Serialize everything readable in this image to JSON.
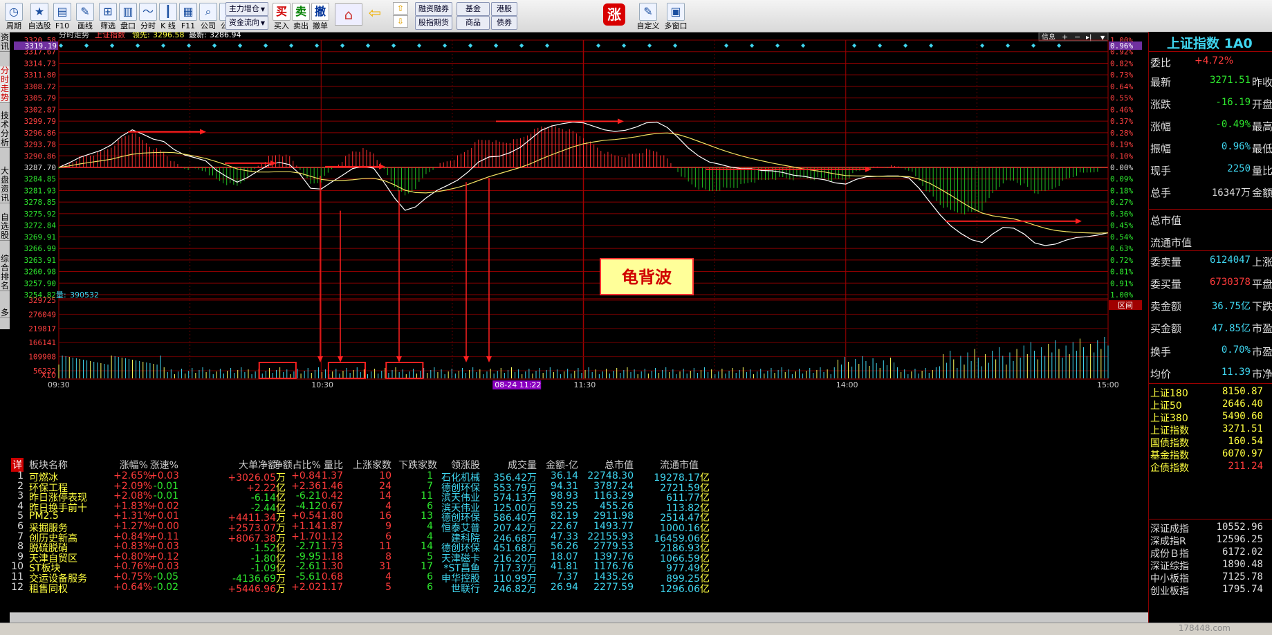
{
  "toolbar": {
    "items": [
      {
        "label": "周期",
        "icon": "clock-icon"
      },
      {
        "label": "自选股",
        "icon": "star-icon"
      },
      {
        "label": "F10",
        "icon": "f10-icon"
      },
      {
        "label": "画线",
        "icon": "pencil-icon"
      },
      {
        "label": "筛选",
        "icon": "filter-icon"
      },
      {
        "label": "盘口",
        "icon": "order-book-icon"
      },
      {
        "label": "分时",
        "icon": "intraday-icon"
      },
      {
        "label": "K 线",
        "icon": "candlestick-icon"
      },
      {
        "label": "F11",
        "icon": "grid-icon"
      },
      {
        "label": "公司",
        "icon": "company-icon"
      },
      {
        "label": "公式",
        "icon": "formula-icon"
      }
    ],
    "dropdowns": [
      "主力增仓",
      "资金流向"
    ],
    "trade": [
      {
        "label": "买入",
        "glyph": "买",
        "color": "#d00000"
      },
      {
        "label": "卖出",
        "glyph": "卖",
        "color": "#008000"
      },
      {
        "label": "撤单",
        "glyph": "撤",
        "color": "#003399"
      }
    ],
    "nav_buttons": [
      "融资融券",
      "基金",
      "港股",
      "股指期货",
      "商品",
      "债券"
    ],
    "zhang_glyph": "涨",
    "right_items": [
      {
        "label": "自定义",
        "icon": "customize-icon"
      },
      {
        "label": "多窗口",
        "icon": "multi-window-icon"
      }
    ]
  },
  "left_tabs": [
    {
      "label": "资讯"
    },
    {
      "label": "分时走势",
      "active": true
    },
    {
      "label": "技术分析"
    },
    {
      "label": "大盘资讯"
    },
    {
      "label": "自选股"
    },
    {
      "label": "综合排名"
    },
    {
      "label": "多"
    }
  ],
  "chart_header": {
    "title": "分时走势",
    "index_name": "上证指数",
    "lead_label": "领先:",
    "lead_value": "3296.58",
    "latest_label": "最新:",
    "latest_value": "3286.94",
    "info_button": "信息",
    "interval_button": "区间"
  },
  "chart_data": {
    "type": "line",
    "prev_close": 3287.7,
    "y_ticks": [
      "3320.58",
      "3317.67",
      "3314.73",
      "3311.80",
      "3308.72",
      "3305.79",
      "3302.87",
      "3299.79",
      "3296.86",
      "3293.78",
      "3290.86",
      "3287.70",
      "3284.85",
      "3281.93",
      "3278.85",
      "3275.92",
      "3272.84",
      "3269.91",
      "3266.99",
      "3263.91",
      "3260.98",
      "3257.90",
      "3254.82"
    ],
    "y_highlight": "3319.19",
    "pct_ticks": [
      "1.00%",
      "0.92%",
      "0.82%",
      "0.73%",
      "0.64%",
      "0.55%",
      "0.46%",
      "0.37%",
      "0.28%",
      "0.19%",
      "0.10%",
      "0.00%",
      "0.09%",
      "0.18%",
      "0.27%",
      "0.36%",
      "0.45%",
      "0.54%",
      "0.63%",
      "0.72%",
      "0.81%",
      "0.91%",
      "1.00%"
    ],
    "pct_highlight": "0.96%",
    "volume_label": "量:",
    "volume_value": "390532",
    "volume_ticks": [
      "329725",
      "276049",
      "219817",
      "166141",
      "109908",
      "56232"
    ],
    "volume_multiplier": "X10",
    "time_labels": [
      "09:30",
      "10:30",
      "11:30",
      "14:00",
      "15:00"
    ],
    "cursor_time": "08-24 11:22",
    "annotation": "龟背波",
    "series": [
      {
        "name": "",
        "values": [
          3287.7,
          3288.9,
          3290.3,
          3291.2,
          3292.1,
          3293.5,
          3295.8,
          3297.4,
          3296.3,
          3295.0,
          3294.4,
          3292.3,
          3290.9,
          3290.2,
          3289.4,
          3287.0,
          3285.3,
          3283.9,
          3285.1,
          3286.8,
          3288.3,
          3289.0,
          3288.4,
          3285.9,
          3282.3,
          3282.1,
          3283.9,
          3285.6,
          3287.4,
          3288.0,
          3287.5,
          3283.8,
          3279.8,
          3276.6,
          3277.5,
          3279.8,
          3281.7,
          3283.0,
          3284.4,
          3286.5,
          3289.1,
          3290.4,
          3290.6,
          3291.5,
          3292.9,
          3295.1,
          3297.3,
          3298.4,
          3299.0,
          3299.4,
          3299.2,
          3298.3,
          3297.4,
          3297.0,
          3297.3,
          3298.1,
          3299.2,
          3299.4,
          3298.0,
          3295.5,
          3292.7,
          3290.6,
          3289.1,
          3288.5,
          3287.8,
          3287.4,
          3287.4,
          3286.9,
          3286.8,
          3286.4,
          3285.7,
          3285.4,
          3284.9,
          3284.5,
          3283.7,
          3283.4,
          3284.6,
          3285.3,
          3285.4,
          3285.5,
          3285.5,
          3285.0,
          3282.3,
          3278.8,
          3275.4,
          3272.6,
          3270.6,
          3269.0,
          3268.3,
          3270.5,
          3272.2,
          3272.0,
          3270.5,
          3268.2,
          3267.5,
          3267.9,
          3268.9,
          3269.6,
          3269.8,
          3270.2,
          3270.8
        ]
      },
      {
        "name": "",
        "values": [
          3287.7,
          3288.1,
          3288.6,
          3289.0,
          3289.4,
          3289.8,
          3290.5,
          3291.1,
          3291.4,
          3291.5,
          3291.6,
          3291.5,
          3291.1,
          3290.6,
          3290.0,
          3289.2,
          3288.3,
          3287.3,
          3286.8,
          3286.5,
          3286.5,
          3286.6,
          3286.6,
          3286.2,
          3285.4,
          3284.6,
          3284.3,
          3284.3,
          3284.5,
          3284.8,
          3284.9,
          3284.3,
          3283.2,
          3281.8,
          3281.2,
          3281.1,
          3281.4,
          3281.9,
          3282.5,
          3283.3,
          3284.3,
          3285.3,
          3286.1,
          3286.9,
          3287.7,
          3288.7,
          3289.9,
          3291.0,
          3292.0,
          3293.0,
          3293.8,
          3294.3,
          3294.7,
          3294.9,
          3295.2,
          3295.6,
          3296.1,
          3296.5,
          3296.6,
          3296.2,
          3295.4,
          3294.4,
          3293.4,
          3292.4,
          3291.5,
          3290.7,
          3290.0,
          3289.4,
          3288.8,
          3288.3,
          3287.8,
          3287.3,
          3286.9,
          3286.5,
          3286.0,
          3285.6,
          3285.5,
          3285.5,
          3285.4,
          3285.4,
          3285.4,
          3285.3,
          3284.7,
          3283.6,
          3282.1,
          3280.5,
          3278.8,
          3277.2,
          3275.9,
          3275.2,
          3274.8,
          3274.4,
          3273.7,
          3272.8,
          3272.0,
          3271.4,
          3271.1,
          3270.9,
          3270.8,
          3270.7,
          3270.8
        ]
      }
    ]
  },
  "table": {
    "headers": [
      "详",
      "板块名称",
      "涨幅%",
      "涨速%",
      "大单净额",
      "净额占比%",
      "量比",
      "上涨家数",
      "下跌家数",
      "领涨股",
      "成交量",
      "金额-亿",
      "总市值",
      "流通市值"
    ],
    "rows": [
      [
        "1",
        "可燃冰",
        "+2.65%",
        "+0.03",
        "+3026.05",
        "万",
        "+0.84",
        "1.37",
        "10",
        "1",
        "石化机械",
        "356.42万",
        "36.14",
        "22748.30",
        "19278.17",
        "亿"
      ],
      [
        "2",
        "环保工程",
        "+2.09%",
        "-0.01",
        "+2.22",
        "亿",
        "+2.36",
        "1.46",
        "24",
        "7",
        "德创环保",
        "553.79万",
        "94.31",
        "3787.24",
        "2721.59",
        "亿"
      ],
      [
        "3",
        "昨日涨停表现",
        "+2.08%",
        "-0.01",
        "-6.14",
        "亿",
        "-6.21",
        "0.42",
        "14",
        "11",
        "滨天伟业",
        "574.13万",
        "98.93",
        "1163.29",
        "611.77",
        "亿"
      ],
      [
        "4",
        "昨日换手前十",
        "+1.83%",
        "+0.02",
        "-2.44",
        "亿",
        "-4.12",
        "0.67",
        "4",
        "6",
        "滨天伟业",
        "125.00万",
        "59.25",
        "455.26",
        "113.82",
        "亿"
      ],
      [
        "5",
        "PM2.5",
        "+1.31%",
        "+0.01",
        "+4411.34",
        "万",
        "+0.54",
        "1.80",
        "16",
        "13",
        "德创环保",
        "586.40万",
        "82.19",
        "2911.98",
        "2514.47",
        "亿"
      ],
      [
        "6",
        "采掘服务",
        "+1.27%",
        "+0.00",
        "+2573.07",
        "万",
        "+1.14",
        "1.87",
        "9",
        "4",
        "恒泰艾普",
        "207.42万",
        "22.67",
        "1493.77",
        "1000.16",
        "亿"
      ],
      [
        "7",
        "创历史新高",
        "+0.84%",
        "+0.11",
        "+8067.38",
        "万",
        "+1.70",
        "1.12",
        "6",
        "4",
        "建科院",
        "246.68万",
        "47.33",
        "22155.93",
        "16459.06",
        "亿"
      ],
      [
        "8",
        "脱硫脱硝",
        "+0.83%",
        "+0.03",
        "-1.52",
        "亿",
        "-2.71",
        "1.73",
        "11",
        "14",
        "德创环保",
        "451.68万",
        "56.26",
        "2779.53",
        "2186.93",
        "亿"
      ],
      [
        "9",
        "天津自贸区",
        "+0.80%",
        "+0.12",
        "-1.80",
        "亿",
        "-9.95",
        "1.18",
        "8",
        "5",
        "天津磁卡",
        "216.20万",
        "18.07",
        "1397.76",
        "1066.59",
        "亿"
      ],
      [
        "10",
        "ST板块",
        "+0.76%",
        "+0.03",
        "-1.09",
        "亿",
        "-2.61",
        "1.30",
        "31",
        "17",
        "*ST昌鱼",
        "717.37万",
        "41.81",
        "1176.76",
        "977.49",
        "亿"
      ],
      [
        "11",
        "交运设备服务",
        "+0.75%",
        "-0.05",
        "-4136.69",
        "万",
        "-5.61",
        "0.68",
        "4",
        "6",
        "申华控股",
        "110.99万",
        "7.37",
        "1435.26",
        "899.25",
        "亿"
      ],
      [
        "12",
        "租售同权",
        "+0.64%",
        "-0.02",
        "+5446.96",
        "万",
        "+2.02",
        "1.17",
        "5",
        "6",
        "世联行",
        "246.82万",
        "26.94",
        "2277.59",
        "1296.06",
        "亿"
      ]
    ]
  },
  "right_panel": {
    "title": "上证指数 1A0",
    "wei_bi_label": "委比",
    "wei_bi_value": "+4.72%",
    "quote": [
      {
        "k": "最新",
        "v": "3271.51",
        "c": "green",
        "k2": "昨收"
      },
      {
        "k": "涨跌",
        "v": "-16.19",
        "c": "green",
        "k2": "开盘"
      },
      {
        "k": "涨幅",
        "v": "-0.49%",
        "c": "green",
        "k2": "最高"
      },
      {
        "k": "振幅",
        "v": "0.96%",
        "c": "cyan",
        "k2": "最低"
      },
      {
        "k": "现手",
        "v": "2250",
        "c": "cyan",
        "k2": "量比"
      },
      {
        "k": "总手",
        "v": "16347万",
        "c": "white",
        "k2": "金额"
      }
    ],
    "mcap": [
      "总市值",
      "流通市值"
    ],
    "orders": [
      {
        "k": "委卖量",
        "v": "6124047",
        "c": "cyan",
        "k2": "上涨家"
      },
      {
        "k": "委买量",
        "v": "6730378",
        "c": "red",
        "k2": "平盘家"
      },
      {
        "k": "卖金额",
        "v": "36.75亿",
        "c": "cyan",
        "k2": "下跌家"
      },
      {
        "k": "买金额",
        "v": "47.85亿",
        "c": "cyan",
        "k2": "市盈"
      }
    ],
    "turnover": [
      {
        "k": "换手",
        "v": "0.70%",
        "c": "cyan",
        "k2": "市盈(动"
      },
      {
        "k": "均价",
        "v": "11.39",
        "c": "cyan",
        "k2": "市净率"
      }
    ],
    "indices_a": [
      {
        "k": "上证180",
        "v": "8150.87",
        "kc": "yellow",
        "vc": "yellow"
      },
      {
        "k": "上证50",
        "v": "2646.40",
        "kc": "yellow",
        "vc": "yellow"
      },
      {
        "k": "上证380",
        "v": "5490.60",
        "kc": "yellow",
        "vc": "yellow"
      },
      {
        "k": "上证指数",
        "v": "3271.51",
        "kc": "yellow",
        "vc": "yellow"
      },
      {
        "k": "国债指数",
        "v": "160.54",
        "kc": "yellow",
        "vc": "yellow"
      },
      {
        "k": "基金指数",
        "v": "6070.97",
        "kc": "yellow",
        "vc": "yellow"
      },
      {
        "k": "企债指数",
        "v": "211.24",
        "kc": "yellow",
        "vc": "red"
      }
    ],
    "indices_b": [
      {
        "k": "深证成指",
        "v": "10552.96"
      },
      {
        "k": "深成指R",
        "v": "12596.25"
      },
      {
        "k": "成份Ｂ指",
        "v": "6172.02"
      },
      {
        "k": "深证综指",
        "v": "1890.48"
      },
      {
        "k": "中小板指",
        "v": "7125.78"
      },
      {
        "k": "创业板指",
        "v": "1795.74"
      }
    ]
  },
  "watermark": "178448.com"
}
